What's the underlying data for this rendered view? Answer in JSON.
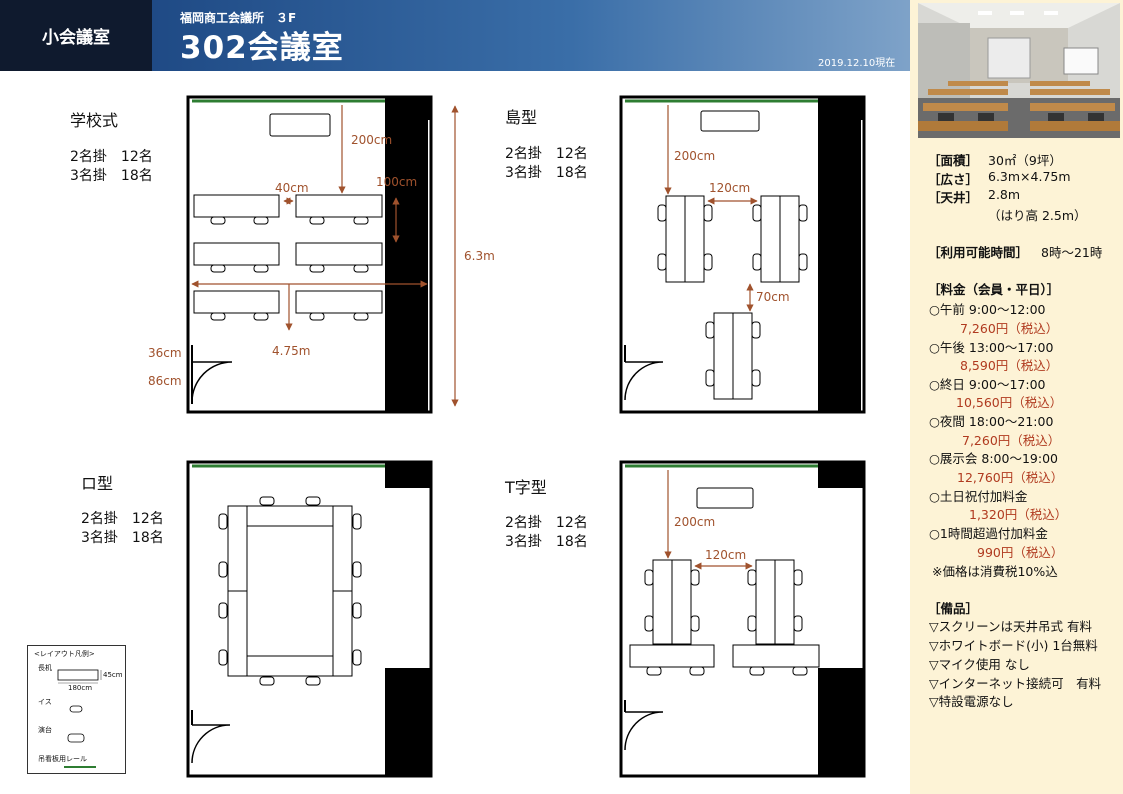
{
  "header": {
    "category": "小会議室",
    "building": "福岡商工会議所　３F",
    "room": "302会議室",
    "date": "2019.12.10現在"
  },
  "specs": {
    "area_label": "［面積］",
    "area_value": "30㎡（9坪）",
    "size_label": "［広さ］",
    "size_value": "6.3m×4.75m",
    "ceiling_label": "［天井］",
    "ceiling_value": "2.8m",
    "ceiling_note": "（はり高 2.5m）",
    "hours_label": "［利用可能時間］",
    "hours_value": "8時～21時"
  },
  "fees": {
    "title": "［料金（会員・平日）］",
    "items": [
      {
        "label": "○午前 9:00～12:00",
        "price": "7,260円（税込）"
      },
      {
        "label": "○午後 13:00～17:00",
        "price": "8,590円（税込）"
      },
      {
        "label": "○終日 9:00～17:00",
        "price": "10,560円（税込）"
      },
      {
        "label": "○夜間 18:00～21:00",
        "price": "7,260円（税込）"
      },
      {
        "label": "○展示会 8:00～19:00",
        "price": "12,760円（税込）"
      },
      {
        "label": "○土日祝付加料金",
        "price": "1,320円（税込）"
      },
      {
        "label": "○1時間超過付加料金",
        "price": "990円（税込）"
      }
    ],
    "note": "※価格は消費税10%込"
  },
  "equipment": {
    "title": "［備品］",
    "items": [
      "▽スクリーンは天井吊式 有料",
      "▽ホワイトボード(小) 1台無料",
      "▽マイク使用 なし",
      "▽インターネット接続可　有料",
      "▽特設電源なし"
    ]
  },
  "plans": {
    "school": {
      "title": "学校式",
      "cap1": "2名掛　12名",
      "cap2": "3名掛　18名"
    },
    "island": {
      "title": "島型",
      "cap1": "2名掛　12名",
      "cap2": "3名掛　18名"
    },
    "square": {
      "title": "ロ型",
      "cap1": "2名掛　12名",
      "cap2": "3名掛　18名"
    },
    "t_shape": {
      "title": "T字型",
      "cap1": "2名掛　12名",
      "cap2": "3名掛　18名"
    }
  },
  "dimensions": {
    "d200": "200cm",
    "d40": "40cm",
    "d100": "100cm",
    "d63": "6.3m",
    "d475": "4.75m",
    "d36": "36cm",
    "d86": "86cm",
    "d120": "120cm",
    "d70": "70cm"
  },
  "legend": {
    "title": "<レイアウト凡例>",
    "desk": "長机",
    "desk_depth": "45cm",
    "desk_width": "180cm",
    "chair": "イス",
    "podium": "演台",
    "rail": "吊看板用レール"
  },
  "colors": {
    "rail": "#2e7d32",
    "dim": "#a0522d",
    "price": "#b03a1f",
    "header": "#1f4a85"
  }
}
